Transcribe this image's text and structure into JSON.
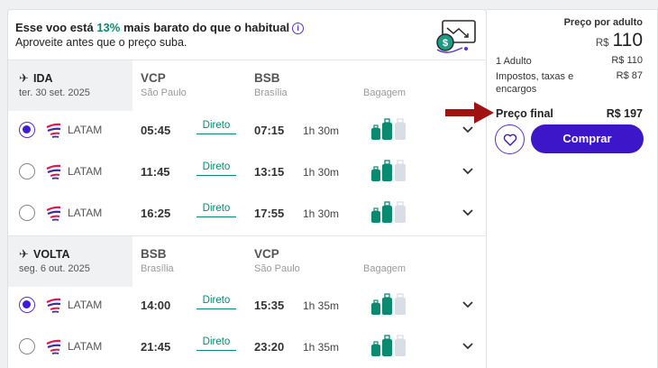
{
  "banner": {
    "line1_a": "Esse voo está ",
    "line1_pct": "13%",
    "line1_b": " mais barato do que o habitual",
    "line2": "Aproveite antes que o preço suba.",
    "info_icon": "info-icon",
    "money_icon": "price-drop-chart-icon"
  },
  "legs": [
    {
      "name": "IDA",
      "date": "ter. 30 set. 2025",
      "from_code": "VCP",
      "from_city": "São Paulo",
      "to_code": "BSB",
      "to_city": "Brasília",
      "baggage_label": "Bagagem",
      "flights": [
        {
          "airline": "LATAM",
          "dep": "05:45",
          "direct": "Direto",
          "arr": "07:15",
          "duration": "1h 30m",
          "selected": true
        },
        {
          "airline": "LATAM",
          "dep": "11:45",
          "direct": "Direto",
          "arr": "13:15",
          "duration": "1h 30m",
          "selected": false
        },
        {
          "airline": "LATAM",
          "dep": "16:25",
          "direct": "Direto",
          "arr": "17:55",
          "duration": "1h 30m",
          "selected": false
        }
      ]
    },
    {
      "name": "VOLTA",
      "date": "seg. 6 out. 2025",
      "from_code": "BSB",
      "from_city": "Brasília",
      "to_code": "VCP",
      "to_city": "São Paulo",
      "baggage_label": "Bagagem",
      "flights": [
        {
          "airline": "LATAM",
          "dep": "14:00",
          "direct": "Direto",
          "arr": "15:35",
          "duration": "1h 35m",
          "selected": true
        },
        {
          "airline": "LATAM",
          "dep": "21:45",
          "direct": "Direto",
          "arr": "23:20",
          "duration": "1h 35m",
          "selected": false
        }
      ]
    }
  ],
  "price": {
    "per_adult_label": "Preço por adulto",
    "currency": "R$",
    "per_adult_value": "110",
    "adults_label": "1 Adulto",
    "adults_value": "R$ 110",
    "taxes_label_1": "Impostos, taxas e",
    "taxes_label_2": "encargos",
    "taxes_value": "R$ 87",
    "final_label": "Preço final",
    "final_value": "R$ 197",
    "buy_label": "Comprar",
    "favorite_icon": "heart-icon"
  },
  "colors": {
    "accent": "#3c16c8",
    "green": "#0b8a72",
    "annotation_arrow": "#a01212"
  }
}
